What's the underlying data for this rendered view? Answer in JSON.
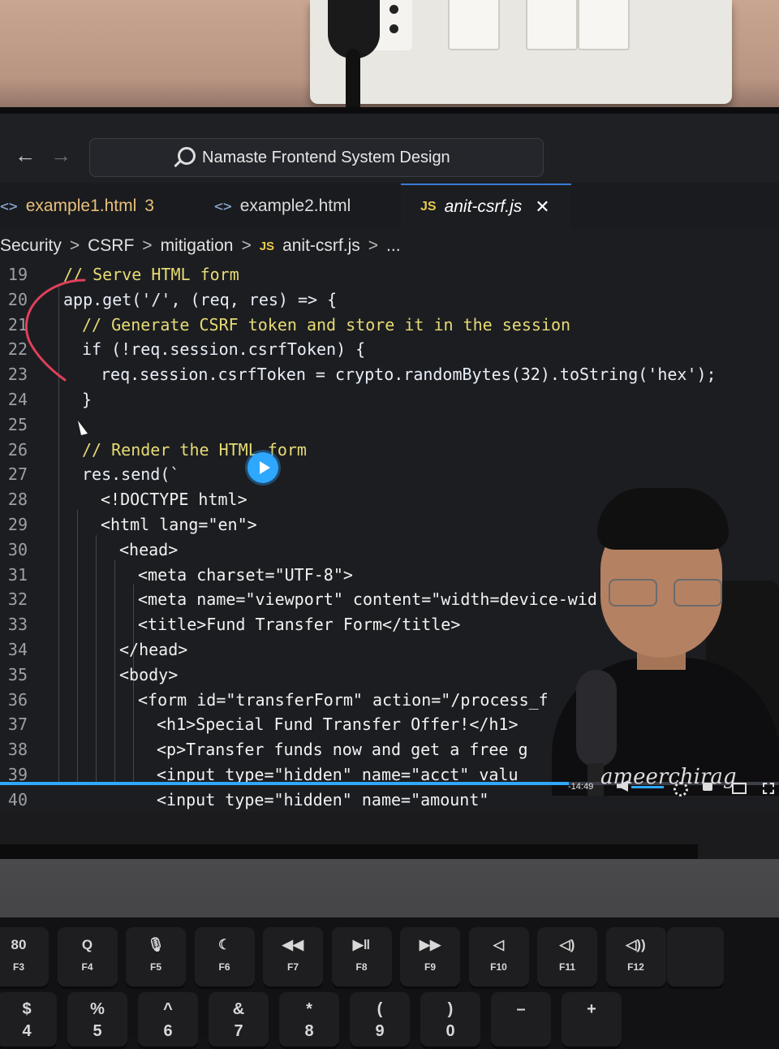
{
  "browser": {
    "search_text": "Namaste Frontend System Design",
    "back_glyph": "←",
    "forward_glyph": "→"
  },
  "tabs": [
    {
      "icon": "<>",
      "label": "example1.html",
      "badge": "3"
    },
    {
      "icon": "<>",
      "label": "example2.html"
    },
    {
      "icon": "JS",
      "label": "anit-csrf.js",
      "close": "✕",
      "active": true
    }
  ],
  "breadcrumb": {
    "items": [
      "Security",
      "CSRF",
      "mitigation"
    ],
    "file_icon": "JS",
    "file": "anit-csrf.js",
    "more": "...",
    "separator": ">"
  },
  "code_lines": [
    {
      "num": "19",
      "indent": 1,
      "text": "// Serve HTML form",
      "kind": "comment"
    },
    {
      "num": "20",
      "indent": 1,
      "text": "app.get('/', (req, res) => {",
      "kind": "code"
    },
    {
      "num": "21",
      "indent": 2,
      "text": "// Generate CSRF token and store it in the session",
      "kind": "comment"
    },
    {
      "num": "22",
      "indent": 2,
      "text": "if (!req.session.csrfToken) {",
      "kind": "code"
    },
    {
      "num": "23",
      "indent": 3,
      "text": "req.session.csrfToken = crypto.randomBytes(32).toString('hex');",
      "kind": "code"
    },
    {
      "num": "24",
      "indent": 2,
      "text": "}",
      "kind": "code"
    },
    {
      "num": "25",
      "indent": 0,
      "text": "",
      "kind": "code"
    },
    {
      "num": "26",
      "indent": 2,
      "text": "// Render the HTML form",
      "kind": "comment"
    },
    {
      "num": "27",
      "indent": 2,
      "text": "res.send(`",
      "kind": "code"
    },
    {
      "num": "28",
      "indent": 3,
      "text": "<!DOCTYPE html>",
      "kind": "string"
    },
    {
      "num": "29",
      "indent": 3,
      "text": "<html lang=\"en\">",
      "kind": "string"
    },
    {
      "num": "30",
      "indent": 4,
      "text": "<head>",
      "kind": "string"
    },
    {
      "num": "31",
      "indent": 5,
      "text": "<meta charset=\"UTF-8\">",
      "kind": "string"
    },
    {
      "num": "32",
      "indent": 5,
      "text": "<meta name=\"viewport\" content=\"width=device-wid",
      "kind": "string"
    },
    {
      "num": "33",
      "indent": 5,
      "text": "<title>Fund Transfer Form</title>",
      "kind": "string"
    },
    {
      "num": "34",
      "indent": 4,
      "text": "</head>",
      "kind": "string"
    },
    {
      "num": "35",
      "indent": 4,
      "text": "<body>",
      "kind": "string"
    },
    {
      "num": "36",
      "indent": 5,
      "text": "<form id=\"transferForm\" action=\"/process_f",
      "kind": "string"
    },
    {
      "num": "37",
      "indent": 6,
      "text": "<h1>Special Fund Transfer Offer!</h1>",
      "kind": "string"
    },
    {
      "num": "38",
      "indent": 6,
      "text": "<p>Transfer funds now and get a free g",
      "kind": "string"
    },
    {
      "num": "39",
      "indent": 6,
      "text": "<input type=\"hidden\" name=\"acct\" valu",
      "kind": "string"
    },
    {
      "num": "40",
      "indent": 6,
      "text": "<input type=\"hidden\" name=\"amount\"",
      "kind": "string"
    }
  ],
  "video": {
    "time": "-14:49",
    "progress": 0.73,
    "watermark": "ameerchirag"
  },
  "keyboard": {
    "fn_row": [
      {
        "glyph": "80",
        "label": "F3"
      },
      {
        "glyph": "Q",
        "label": "F4"
      },
      {
        "glyph": "🎙",
        "label": "F5"
      },
      {
        "glyph": "☾",
        "label": "F6"
      },
      {
        "glyph": "◀◀",
        "label": "F7"
      },
      {
        "glyph": "▶‖",
        "label": "F8"
      },
      {
        "glyph": "▶▶",
        "label": "F9"
      },
      {
        "glyph": "◁",
        "label": "F10"
      },
      {
        "glyph": "◁)",
        "label": "F11"
      },
      {
        "glyph": "◁))",
        "label": "F12"
      }
    ],
    "num_row": [
      {
        "top": "$",
        "bottom": "4"
      },
      {
        "top": "%",
        "bottom": "5"
      },
      {
        "top": "^",
        "bottom": "6"
      },
      {
        "top": "&",
        "bottom": "7"
      },
      {
        "top": "*",
        "bottom": "8"
      },
      {
        "top": "(",
        "bottom": "9"
      },
      {
        "top": ")",
        "bottom": "0"
      },
      {
        "top": "–",
        "bottom": ""
      },
      {
        "top": "+",
        "bottom": ""
      }
    ]
  },
  "colors": {
    "comment": "#e6db74",
    "accent": "#2ea7ff",
    "annotation": "#e0405a"
  }
}
